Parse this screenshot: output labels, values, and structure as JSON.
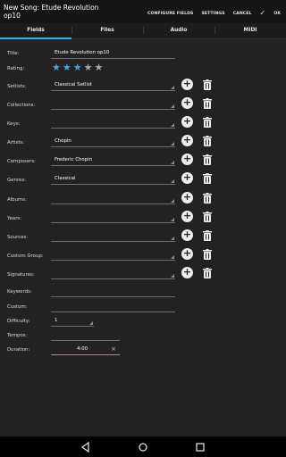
{
  "header": {
    "title": "New Song: Etude Revolution\nop10",
    "actions": {
      "configure": "CONFIGURE FIELDS",
      "settings": "SETTINGS",
      "cancel": "CANCEL",
      "check": "✓",
      "ok": "OK"
    }
  },
  "tabs": [
    "Fields",
    "Files",
    "Audio",
    "MIDI"
  ],
  "fields": {
    "title": {
      "label": "Title:",
      "value": "Etude Revolution op10"
    },
    "rating": {
      "label": "Rating:",
      "stars_filled": 3,
      "stars_total": 5
    },
    "setlists": {
      "label": "Setlists:",
      "value": "Classical Setlist"
    },
    "collections": {
      "label": "Collections:",
      "value": ""
    },
    "keys": {
      "label": "Keys:",
      "value": ""
    },
    "artists": {
      "label": "Artists:",
      "value": "Chopin"
    },
    "composers": {
      "label": "Composers:",
      "value": "Frederic Chopin"
    },
    "genres": {
      "label": "Genres:",
      "value": "Classical"
    },
    "albums": {
      "label": "Albums:",
      "value": ""
    },
    "years": {
      "label": "Years:",
      "value": ""
    },
    "sources": {
      "label": "Sources:",
      "value": ""
    },
    "custom_group": {
      "label": "Custom Group:",
      "value": ""
    },
    "signatures": {
      "label": "Signatures:",
      "value": ""
    },
    "keywords": {
      "label": "Keywords:",
      "value": ""
    },
    "custom": {
      "label": "Custom:",
      "value": ""
    },
    "difficulty": {
      "label": "Difficulty:",
      "value": "1"
    },
    "tempos": {
      "label": "Tempos:",
      "value": ""
    },
    "duration": {
      "label": "Duration:",
      "value": "4:00"
    }
  },
  "colors": {
    "accent": "#33b5e5",
    "star_on": "#4aa3d8",
    "star_off": "#a8a8a8",
    "background": "#222222"
  },
  "icons": {
    "add": "plus-circle-icon",
    "delete": "trash-icon",
    "clear": "close-icon",
    "nav": [
      "back-icon",
      "home-icon",
      "recents-icon"
    ]
  }
}
